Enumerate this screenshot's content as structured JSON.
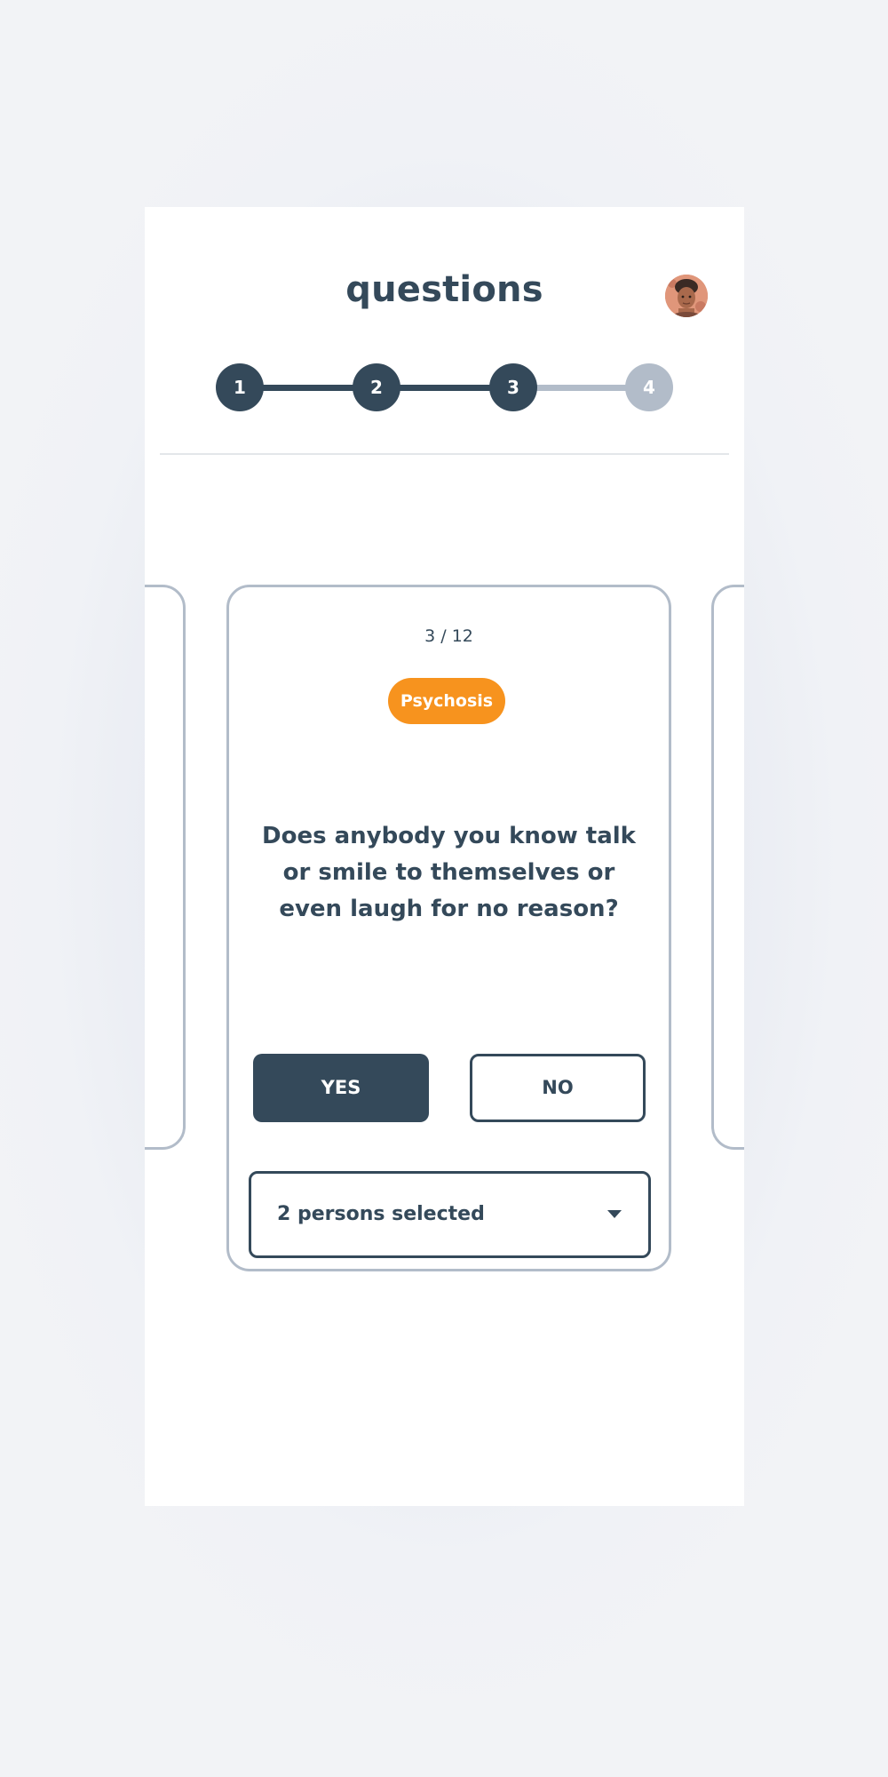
{
  "header": {
    "title": "questions"
  },
  "stepper": {
    "steps": [
      {
        "label": "1",
        "state": "done"
      },
      {
        "label": "2",
        "state": "done"
      },
      {
        "label": "3",
        "state": "current"
      },
      {
        "label": "4",
        "state": "todo"
      }
    ],
    "current_step": 3
  },
  "card": {
    "progress": "3 / 12",
    "category": "Psychosis",
    "question": "Does anybody you know talk or smile to themselves or even laugh for no reason?",
    "yes_label": "YES",
    "no_label": "NO",
    "selected_answer": "YES",
    "persons_select": {
      "value": "2 persons selected"
    }
  },
  "colors": {
    "primary": "#34495a",
    "inactive": "#b2bcc9",
    "accent": "#f7931e",
    "background": "#ffffff"
  },
  "icons": {
    "avatar": "user-avatar",
    "dropdown": "caret-down-icon"
  }
}
